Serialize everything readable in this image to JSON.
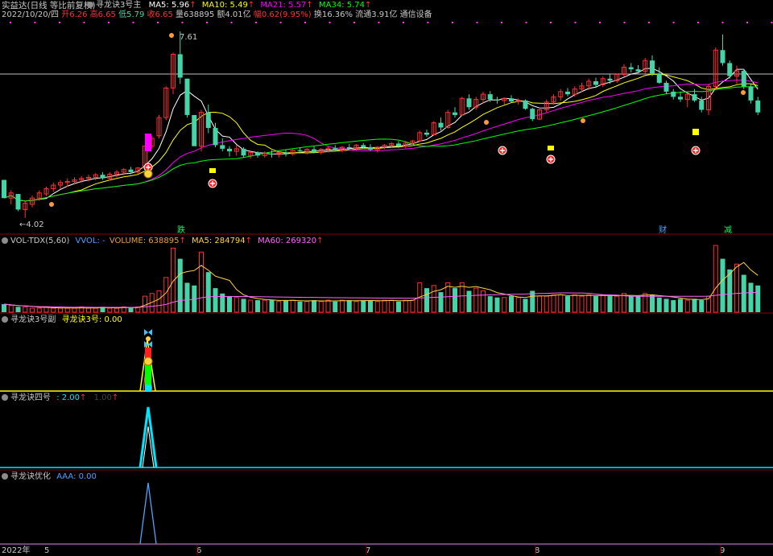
{
  "header": {
    "app_title": "实益达(日线 等比前复权)",
    "indicator_name": "寻龙诀3号主",
    "ma": [
      {
        "label": "MA5: 5.96",
        "color": "#ffffff"
      },
      {
        "label": "MA10: 5.49",
        "color": "#ffff00"
      },
      {
        "label": "MA21: 5.57",
        "color": "#ff00ff"
      },
      {
        "label": "MA34: 5.74",
        "color": "#00ff00"
      }
    ],
    "info": {
      "date": "2022/10/20/四",
      "open": "开6.26",
      "high": "高6.65",
      "low": "低5.79",
      "close": "收6.65",
      "volume": "量638895",
      "amount": "额4.01亿",
      "change": "幅0.62(9.95%)",
      "turnover": "换16.36%",
      "float": "流通3.91亿",
      "sector": "通信设备"
    }
  },
  "price_panel": {
    "high_label": "7.61",
    "low_label": "4.02",
    "signals": [
      {
        "text": "跌",
        "color": "#00ff66"
      },
      {
        "text": "财",
        "color": "#4aa3ff"
      },
      {
        "text": "减",
        "color": "#00ff66"
      }
    ]
  },
  "vol_panel": {
    "name": "VOL-TDX(5,60)",
    "items": [
      {
        "label": "VVOL: -",
        "color": "#4aa3ff"
      },
      {
        "label": "VOLUME: 638895",
        "color": "#e8a040"
      },
      {
        "label": "MA5: 284794",
        "color": "#ffd23f"
      },
      {
        "label": "MA60: 269320",
        "color": "#ff66ff"
      }
    ]
  },
  "panel3": {
    "name": "寻龙诀3号副",
    "value": "寻龙诀3号: 0.00",
    "value_color": "#ffff00"
  },
  "panel4": {
    "name": "寻龙诀四号",
    "value": ": 2.00",
    "value_color": "#00e5ff",
    "value2": "1.00",
    "value2_color": "#444444"
  },
  "panel5": {
    "name": "寻龙诀优化",
    "value": "AAA: 0.00",
    "value_color": "#4aa3ff"
  },
  "x_axis": {
    "year_label": "2022年",
    "labels": [
      "5",
      "6",
      "7",
      "8",
      "9"
    ]
  },
  "colors": {
    "up": "#ff3030",
    "down": "#44d4a8",
    "grid": "#8b0000",
    "text": "#c0c0c0"
  },
  "chart_data": {
    "type": "candlestick",
    "ohlc": [
      [
        4.75,
        4.75,
        4.4,
        4.4
      ],
      [
        4.4,
        4.55,
        4.28,
        4.5
      ],
      [
        4.48,
        4.48,
        4.15,
        4.18
      ],
      [
        4.18,
        4.35,
        4.02,
        4.3
      ],
      [
        4.28,
        4.45,
        4.22,
        4.4
      ],
      [
        4.4,
        4.55,
        4.35,
        4.5
      ],
      [
        4.48,
        4.62,
        4.44,
        4.58
      ],
      [
        4.58,
        4.7,
        4.52,
        4.65
      ],
      [
        4.65,
        4.75,
        4.58,
        4.7
      ],
      [
        4.7,
        4.78,
        4.62,
        4.72
      ],
      [
        4.72,
        4.8,
        4.66,
        4.75
      ],
      [
        4.75,
        4.82,
        4.7,
        4.78
      ],
      [
        4.78,
        4.85,
        4.72,
        4.8
      ],
      [
        4.8,
        4.88,
        4.74,
        4.85
      ],
      [
        4.85,
        4.9,
        4.75,
        4.78
      ],
      [
        4.78,
        4.9,
        4.74,
        4.86
      ],
      [
        4.86,
        4.94,
        4.8,
        4.9
      ],
      [
        4.9,
        4.98,
        4.84,
        4.95
      ],
      [
        4.95,
        5.0,
        4.86,
        4.9
      ],
      [
        4.9,
        5.0,
        4.86,
        4.98
      ],
      [
        4.98,
        5.4,
        4.96,
        5.4
      ],
      [
        5.4,
        5.6,
        5.35,
        5.55
      ],
      [
        5.6,
        6.0,
        5.55,
        5.95
      ],
      [
        5.95,
        6.55,
        5.9,
        6.52
      ],
      [
        6.52,
        7.2,
        6.4,
        7.17
      ],
      [
        7.17,
        7.61,
        6.6,
        6.72
      ],
      [
        6.7,
        6.7,
        5.95,
        6.0
      ],
      [
        6.0,
        6.0,
        5.4,
        5.4
      ],
      [
        5.4,
        6.1,
        5.3,
        6.05
      ],
      [
        6.05,
        6.2,
        5.65,
        5.75
      ],
      [
        5.75,
        5.85,
        5.38,
        5.42
      ],
      [
        5.42,
        5.55,
        5.3,
        5.35
      ],
      [
        5.35,
        5.4,
        5.2,
        5.3
      ],
      [
        5.3,
        5.42,
        5.22,
        5.35
      ],
      [
        5.35,
        5.38,
        5.18,
        5.22
      ],
      [
        5.22,
        5.3,
        5.16,
        5.28
      ],
      [
        5.28,
        5.3,
        5.18,
        5.22
      ],
      [
        5.22,
        5.3,
        5.18,
        5.26
      ],
      [
        5.26,
        5.32,
        5.18,
        5.24
      ],
      [
        5.24,
        5.3,
        5.18,
        5.28
      ],
      [
        5.28,
        5.34,
        5.2,
        5.25
      ],
      [
        5.25,
        5.34,
        5.22,
        5.32
      ],
      [
        5.32,
        5.38,
        5.26,
        5.3
      ],
      [
        5.3,
        5.36,
        5.24,
        5.34
      ],
      [
        5.34,
        5.4,
        5.26,
        5.28
      ],
      [
        5.28,
        5.36,
        5.24,
        5.34
      ],
      [
        5.34,
        5.4,
        5.28,
        5.36
      ],
      [
        5.36,
        5.42,
        5.3,
        5.32
      ],
      [
        5.32,
        5.4,
        5.28,
        5.38
      ],
      [
        5.38,
        5.44,
        5.32,
        5.36
      ],
      [
        5.36,
        5.44,
        5.32,
        5.42
      ],
      [
        5.42,
        5.46,
        5.34,
        5.38
      ],
      [
        5.38,
        5.44,
        5.3,
        5.33
      ],
      [
        5.33,
        5.4,
        5.28,
        5.38
      ],
      [
        5.38,
        5.44,
        5.34,
        5.42
      ],
      [
        5.42,
        5.48,
        5.36,
        5.45
      ],
      [
        5.45,
        5.5,
        5.36,
        5.4
      ],
      [
        5.4,
        5.48,
        5.36,
        5.46
      ],
      [
        5.46,
        5.52,
        5.4,
        5.5
      ],
      [
        5.5,
        5.7,
        5.48,
        5.66
      ],
      [
        5.66,
        5.72,
        5.58,
        5.62
      ],
      [
        5.62,
        5.88,
        5.6,
        5.85
      ],
      [
        5.85,
        5.95,
        5.7,
        5.76
      ],
      [
        5.76,
        6.1,
        5.74,
        6.05
      ],
      [
        6.05,
        6.15,
        5.95,
        6.0
      ],
      [
        6.0,
        6.35,
        5.98,
        6.32
      ],
      [
        6.32,
        6.4,
        6.1,
        6.15
      ],
      [
        6.15,
        6.35,
        6.1,
        6.3
      ],
      [
        6.3,
        6.45,
        6.22,
        6.4
      ],
      [
        6.4,
        6.46,
        6.25,
        6.3
      ],
      [
        6.3,
        6.35,
        6.22,
        6.28
      ],
      [
        6.28,
        6.34,
        6.2,
        6.32
      ],
      [
        6.32,
        6.38,
        6.24,
        6.26
      ],
      [
        6.26,
        6.32,
        6.2,
        6.28
      ],
      [
        6.28,
        6.3,
        6.1,
        6.12
      ],
      [
        6.12,
        6.14,
        5.88,
        5.92
      ],
      [
        5.92,
        6.15,
        5.9,
        6.1
      ],
      [
        6.1,
        6.3,
        6.05,
        6.25
      ],
      [
        6.25,
        6.4,
        6.2,
        6.35
      ],
      [
        6.35,
        6.5,
        6.28,
        6.45
      ],
      [
        6.45,
        6.52,
        6.36,
        6.4
      ],
      [
        6.4,
        6.55,
        6.35,
        6.5
      ],
      [
        6.5,
        6.62,
        6.44,
        6.56
      ],
      [
        6.56,
        6.7,
        6.48,
        6.65
      ],
      [
        6.65,
        6.72,
        6.52,
        6.58
      ],
      [
        6.58,
        6.74,
        6.54,
        6.7
      ],
      [
        6.7,
        6.8,
        6.6,
        6.66
      ],
      [
        6.66,
        6.8,
        6.62,
        6.78
      ],
      [
        6.78,
        6.98,
        6.74,
        6.92
      ],
      [
        6.92,
        7.0,
        6.82,
        6.88
      ],
      [
        6.88,
        6.96,
        6.8,
        6.84
      ],
      [
        6.84,
        7.1,
        6.8,
        7.05
      ],
      [
        7.05,
        7.15,
        6.75,
        6.8
      ],
      [
        6.8,
        6.92,
        6.6,
        6.62
      ],
      [
        6.62,
        6.66,
        6.4,
        6.45
      ],
      [
        6.45,
        6.5,
        6.3,
        6.35
      ],
      [
        6.35,
        6.45,
        6.25,
        6.3
      ],
      [
        6.3,
        6.42,
        6.15,
        6.4
      ],
      [
        6.4,
        6.5,
        6.25,
        6.28
      ],
      [
        6.28,
        6.35,
        6.05,
        6.1
      ],
      [
        6.1,
        6.6,
        6.0,
        6.55
      ],
      [
        6.55,
        7.3,
        6.5,
        7.25
      ],
      [
        7.25,
        7.55,
        6.95,
        7.0
      ],
      [
        7.0,
        7.05,
        6.7,
        6.75
      ],
      [
        6.75,
        6.95,
        6.6,
        6.85
      ],
      [
        6.85,
        6.88,
        6.5,
        6.55
      ],
      [
        6.55,
        6.6,
        6.22,
        6.28
      ],
      [
        6.28,
        6.35,
        6.0,
        6.05
      ]
    ],
    "volume": [
      6,
      5,
      4,
      4,
      3,
      3,
      4,
      3,
      3,
      3,
      3,
      4,
      3,
      3,
      4,
      3,
      3,
      4,
      3,
      4,
      12,
      14,
      16,
      26,
      48,
      40,
      22,
      20,
      45,
      30,
      18,
      14,
      12,
      11,
      10,
      9,
      9,
      9,
      9,
      8,
      9,
      9,
      8,
      8,
      9,
      8,
      9,
      8,
      9,
      9,
      8,
      9,
      9,
      8,
      9,
      9,
      8,
      9,
      9,
      22,
      18,
      20,
      15,
      22,
      18,
      22,
      16,
      18,
      16,
      12,
      11,
      11,
      12,
      11,
      10,
      16,
      12,
      12,
      13,
      13,
      12,
      13,
      12,
      13,
      12,
      13,
      12,
      12,
      14,
      12,
      12,
      14,
      13,
      11,
      10,
      9,
      10,
      9,
      10,
      9,
      12,
      50,
      40,
      32,
      36,
      28,
      22,
      20
    ]
  }
}
